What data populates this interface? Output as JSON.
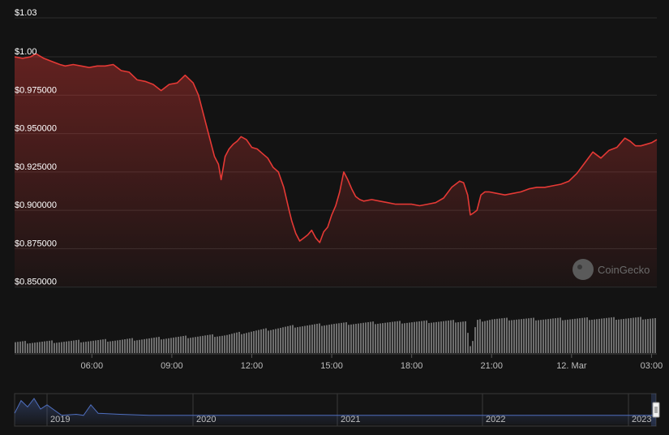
{
  "chart_data": {
    "type": "area",
    "y_tick_labels": [
      "$1.03",
      "$1.00",
      "$0.975000",
      "$0.950000",
      "$0.925000",
      "$0.900000",
      "$0.875000",
      "$0.850000"
    ],
    "x_tick_labels": [
      "06:00",
      "09:00",
      "12:00",
      "15:00",
      "18:00",
      "21:00",
      "12. Mar",
      "03:00"
    ],
    "navigator_labels": [
      "2019",
      "2020",
      "2021",
      "2022",
      "2023"
    ],
    "ylim": [
      0.85,
      1.03
    ],
    "x_range_hours": [
      3.1,
      27.2
    ],
    "grid": true,
    "series": [
      {
        "role": "price",
        "x": [
          3.1,
          3.4,
          3.7,
          3.9,
          4.2,
          4.5,
          4.8,
          5.0,
          5.3,
          5.6,
          5.9,
          6.2,
          6.5,
          6.8,
          7.1,
          7.4,
          7.7,
          8.0,
          8.3,
          8.6,
          8.9,
          9.2,
          9.5,
          9.8,
          10.0,
          10.3,
          10.6,
          10.75,
          10.85,
          11.0,
          11.15,
          11.3,
          11.45,
          11.6,
          11.8,
          12.0,
          12.2,
          12.4,
          12.6,
          12.8,
          13.0,
          13.2,
          13.4,
          13.5,
          13.65,
          13.8,
          13.95,
          14.1,
          14.25,
          14.4,
          14.55,
          14.7,
          14.85,
          15.0,
          15.15,
          15.3,
          15.45,
          15.6,
          15.75,
          15.9,
          16.05,
          16.2,
          16.5,
          16.8,
          17.1,
          17.4,
          17.7,
          18.0,
          18.3,
          18.6,
          18.9,
          19.2,
          19.5,
          19.8,
          19.95,
          20.1,
          20.2,
          20.3,
          20.45,
          20.6,
          20.75,
          20.9,
          21.2,
          21.5,
          21.8,
          22.1,
          22.4,
          22.7,
          23.0,
          23.3,
          23.6,
          23.9,
          24.2,
          24.5,
          24.8,
          25.1,
          25.4,
          25.7,
          26.0,
          26.2,
          26.4,
          26.6,
          26.8,
          27.0,
          27.2
        ],
        "values": [
          1.0,
          0.999,
          1.0,
          1.002,
          0.999,
          0.997,
          0.995,
          0.994,
          0.995,
          0.994,
          0.993,
          0.994,
          0.994,
          0.995,
          0.991,
          0.99,
          0.985,
          0.984,
          0.982,
          0.978,
          0.982,
          0.983,
          0.988,
          0.983,
          0.975,
          0.955,
          0.935,
          0.93,
          0.92,
          0.935,
          0.94,
          0.943,
          0.945,
          0.948,
          0.946,
          0.941,
          0.94,
          0.937,
          0.934,
          0.928,
          0.925,
          0.915,
          0.9,
          0.893,
          0.885,
          0.88,
          0.882,
          0.884,
          0.887,
          0.882,
          0.879,
          0.886,
          0.889,
          0.897,
          0.903,
          0.912,
          0.925,
          0.92,
          0.914,
          0.909,
          0.907,
          0.906,
          0.907,
          0.906,
          0.905,
          0.904,
          0.904,
          0.904,
          0.903,
          0.904,
          0.905,
          0.908,
          0.915,
          0.919,
          0.918,
          0.91,
          0.897,
          0.898,
          0.9,
          0.91,
          0.912,
          0.912,
          0.911,
          0.91,
          0.911,
          0.912,
          0.914,
          0.915,
          0.915,
          0.916,
          0.917,
          0.919,
          0.924,
          0.931,
          0.938,
          0.934,
          0.939,
          0.941,
          0.947,
          0.945,
          0.942,
          0.942,
          0.943,
          0.944,
          0.946
        ]
      },
      {
        "role": "volume",
        "x": [
          3.1,
          5.0,
          7.0,
          9.0,
          10.5,
          11.0,
          12.0,
          13.5,
          15.0,
          17.0,
          19.0,
          20.0,
          20.2,
          20.4,
          21.0,
          23.0,
          25.0,
          27.2
        ],
        "values": [
          0.22,
          0.24,
          0.27,
          0.32,
          0.36,
          0.37,
          0.45,
          0.55,
          0.6,
          0.63,
          0.65,
          0.66,
          0.05,
          0.66,
          0.7,
          0.7,
          0.71,
          0.72
        ]
      },
      {
        "role": "navigator",
        "x": [
          2018.75,
          2018.8,
          2018.85,
          2018.9,
          2018.95,
          2019.0,
          2019.1,
          2019.2,
          2019.25,
          2019.3,
          2019.35,
          2019.5,
          2019.7,
          2020.0,
          2020.5,
          2021.0,
          2021.5,
          2022.0,
          2022.5,
          2023.0,
          2023.2
        ],
        "values": [
          0.3,
          0.9,
          0.6,
          1.0,
          0.5,
          0.7,
          0.2,
          0.25,
          0.2,
          0.7,
          0.3,
          0.25,
          0.2,
          0.2,
          0.2,
          0.2,
          0.2,
          0.2,
          0.2,
          0.2,
          0.2
        ]
      }
    ]
  },
  "watermark": {
    "text": "CoinGecko"
  },
  "colors": {
    "line": "#e53935",
    "grid": "#2e2e2e",
    "volume": "#6e6e6e",
    "navigator_line": "#4f6fbf",
    "background": "#131313"
  }
}
